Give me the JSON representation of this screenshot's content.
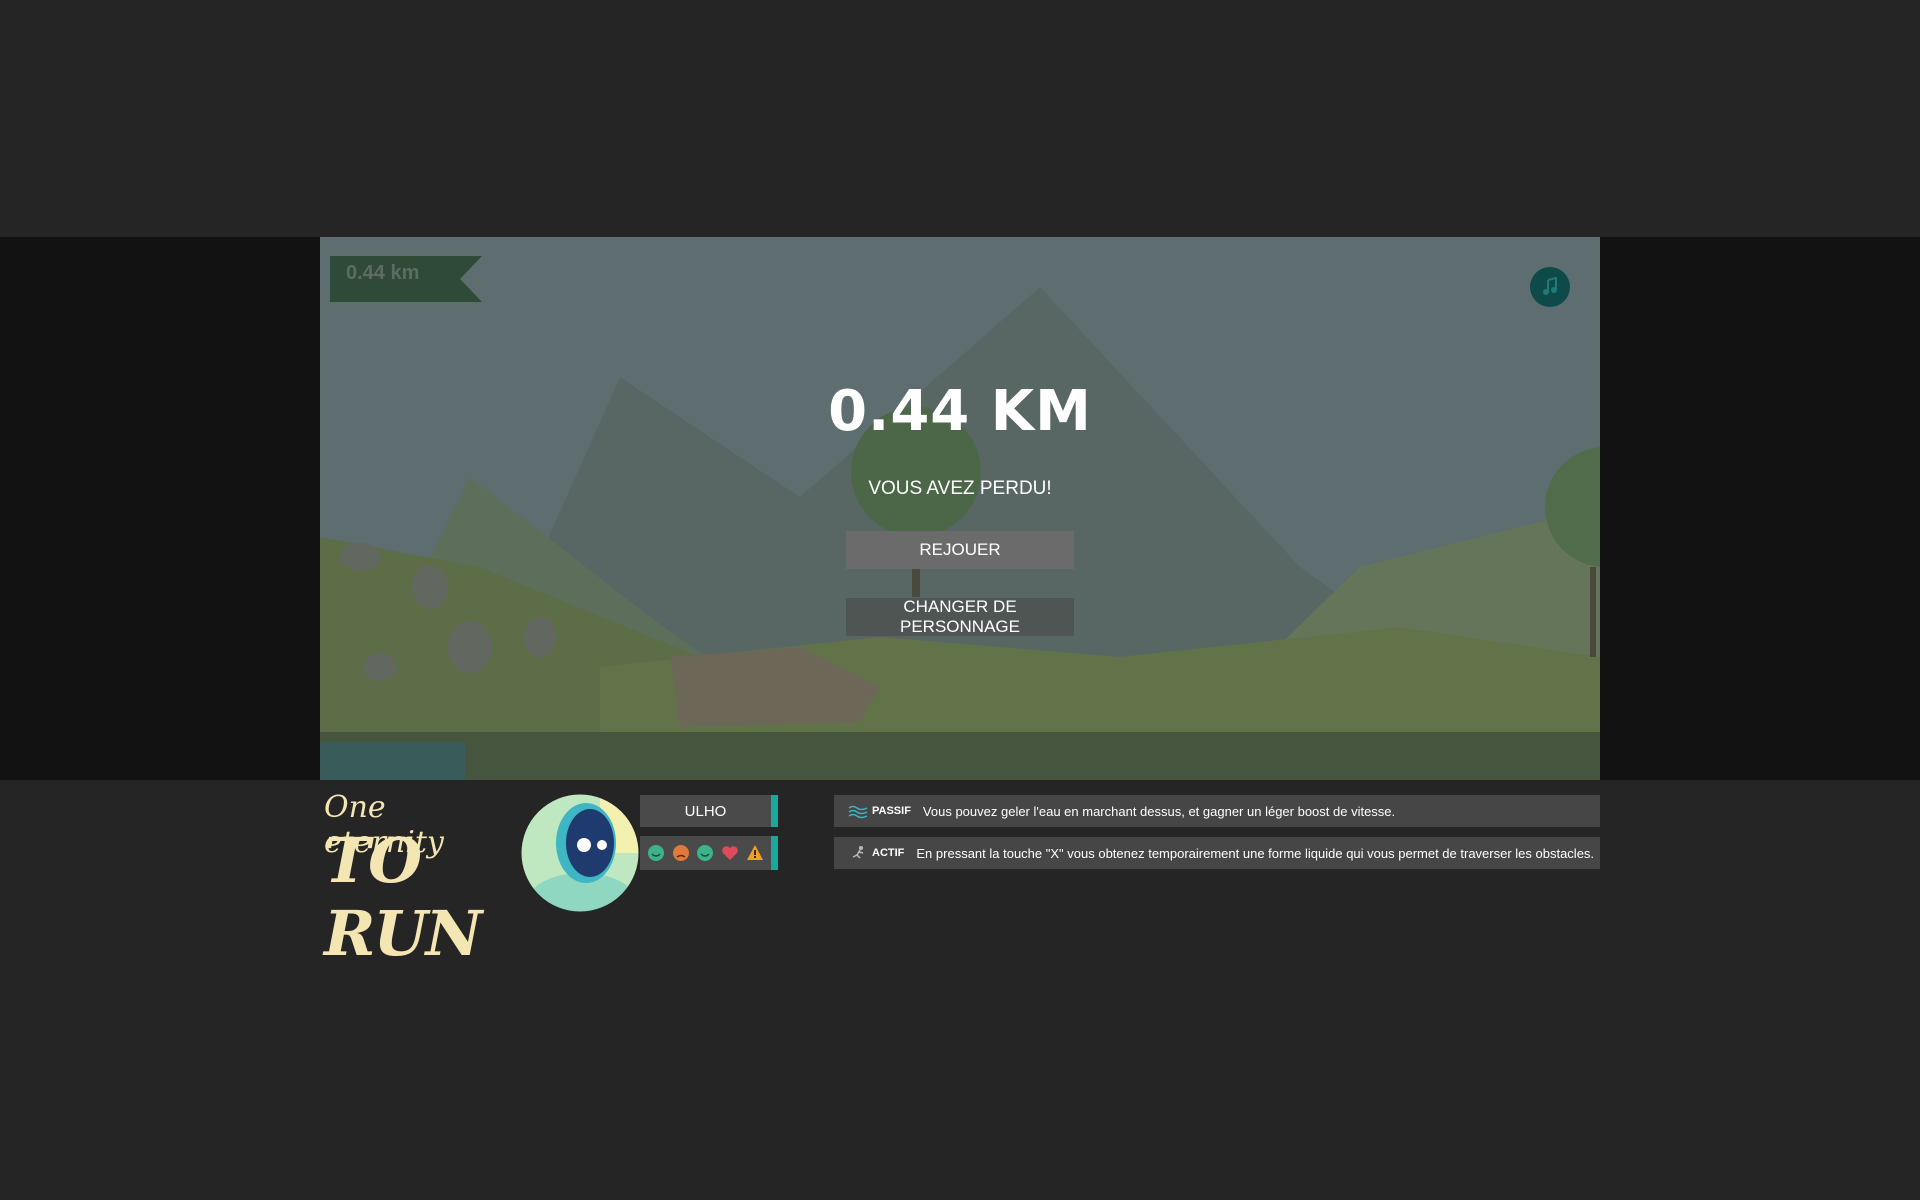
{
  "hud": {
    "distance_flag": "0.44 km",
    "music_icon": "music-note-icon"
  },
  "game_over": {
    "score": "0.44 KM",
    "message": "VOUS AVEZ PERDU!",
    "replay_label": "REJOUER",
    "change_character_label": "CHANGER DE PERSONNAGE"
  },
  "logo": {
    "line1": "One eternity",
    "line2": "TO RUN"
  },
  "character": {
    "name": "ULHO",
    "stat_icons": [
      "happy-face-icon",
      "angry-face-icon",
      "happy-face-icon",
      "heart-icon",
      "warning-icon"
    ]
  },
  "abilities": {
    "passive": {
      "tag": "PASSIF",
      "icon": "water-waves-icon",
      "text": "Vous pouvez geler l'eau en marchant dessus, et gagner un léger boost de vitesse."
    },
    "active": {
      "tag": "ACTIF",
      "icon": "running-figure-icon",
      "text": "En pressant la touche \"X\" vous obtenez temporairement une forme liquide qui vous permet de traverser les obstacles."
    }
  },
  "colors": {
    "page_bg": "#252525",
    "accent_teal": "#18a89c",
    "logo_cream": "#f3e6b2"
  }
}
